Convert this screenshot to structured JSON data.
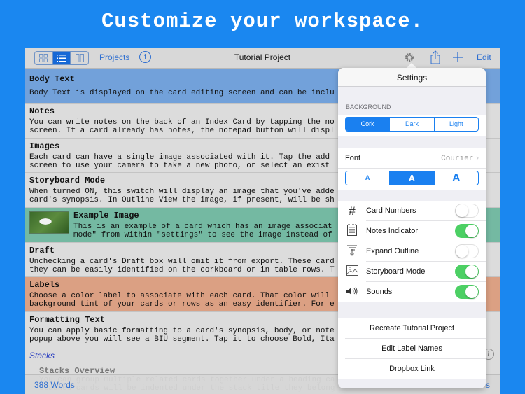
{
  "headline": "Customize your workspace.",
  "navbar": {
    "view_modes": [
      "grid-view",
      "list-view",
      "column-view"
    ],
    "active_view": "list-view",
    "projects_label": "Projects",
    "info_label": "i",
    "title": "Tutorial Project",
    "edit_label": "Edit"
  },
  "cards": [
    {
      "title": "Body Text",
      "lines": [
        "Body Text is displayed on the card editing screen and can be inclu"
      ],
      "color": "blue"
    },
    {
      "title": "Notes",
      "lines": [
        "You can write notes on the back of an Index Card by tapping the no",
        "screen. If a card already has notes, the notepad button will displ"
      ],
      "color": "none"
    },
    {
      "title": "Images",
      "lines": [
        "Each card can have a single image associated with it. Tap the add",
        "screen to use your camera to take a new photo, or select an exist"
      ],
      "color": "none"
    },
    {
      "title": "Storyboard Mode",
      "lines": [
        "When turned ON, this switch will display an image that you've adde",
        "card's synopsis. In Outline View the image, if present, will be sh"
      ],
      "color": "none"
    },
    {
      "title": "Example Image",
      "lines": [
        "This is an example of a card which has an image associat",
        "mode\" from within \"settings\" to see the image instead of"
      ],
      "color": "green"
    },
    {
      "title": "Draft",
      "lines": [
        "Unchecking a card's Draft box will omit it from export. These card",
        "they can be easily identified on the corkboard or in table rows. T"
      ],
      "color": "none"
    },
    {
      "title": "Labels",
      "lines": [
        "Choose a color label to associate with each card. That color will",
        "background tint of your cards or rows as an easy identifier. For e"
      ],
      "color": "orange"
    },
    {
      "title": "Formatting Text",
      "lines": [
        "You can apply basic formatting to a card's synopsis, body, or note",
        "popup above you will see a BIU segment. Tap it to choose Bold, Ita"
      ],
      "color": "none"
    }
  ],
  "right_overflow": [
    "ig",
    "...",
    "ig",
    "a.",
    "...",
    "rd",
    "...",
    "...",
    "...",
    "e",
    "..."
  ],
  "section": {
    "label": "Stacks"
  },
  "faded_card": {
    "title": "Stacks Overview",
    "lines": [
      "You can group multiple related cards together under a heading ca",
      "stacked cards will be indented under the stack title they belong"
    ]
  },
  "bottom_bar": {
    "word_count": "388 Words",
    "right_label": "s"
  },
  "settings": {
    "title": "Settings",
    "background_label": "BACKGROUND",
    "background_options": [
      "Cork",
      "Dark",
      "Light"
    ],
    "background_selected": "Cork",
    "font_label": "Font",
    "font_value": "Courier",
    "font_sizes": [
      "A",
      "A",
      "A"
    ],
    "font_size_selected": 1,
    "toggles": [
      {
        "icon": "hash-icon",
        "glyph": "#",
        "label": "Card Numbers",
        "on": false
      },
      {
        "icon": "notepad-icon",
        "glyph": "",
        "label": "Notes Indicator",
        "on": true
      },
      {
        "icon": "expand-outline-icon",
        "glyph": "",
        "label": "Expand Outline",
        "on": false
      },
      {
        "icon": "image-icon",
        "glyph": "",
        "label": "Storyboard Mode",
        "on": true
      },
      {
        "icon": "speaker-icon",
        "glyph": "◀))",
        "label": "Sounds",
        "on": true
      }
    ],
    "actions": [
      "Recreate Tutorial Project",
      "Edit Label Names",
      "Dropbox Link"
    ]
  },
  "colors": {
    "background": "#1a87f0",
    "accent": "#1a80f0",
    "switch_on": "#4cd064",
    "label_blue": "#72a1da",
    "label_green": "#74b9a2",
    "label_orange": "#dba083"
  }
}
